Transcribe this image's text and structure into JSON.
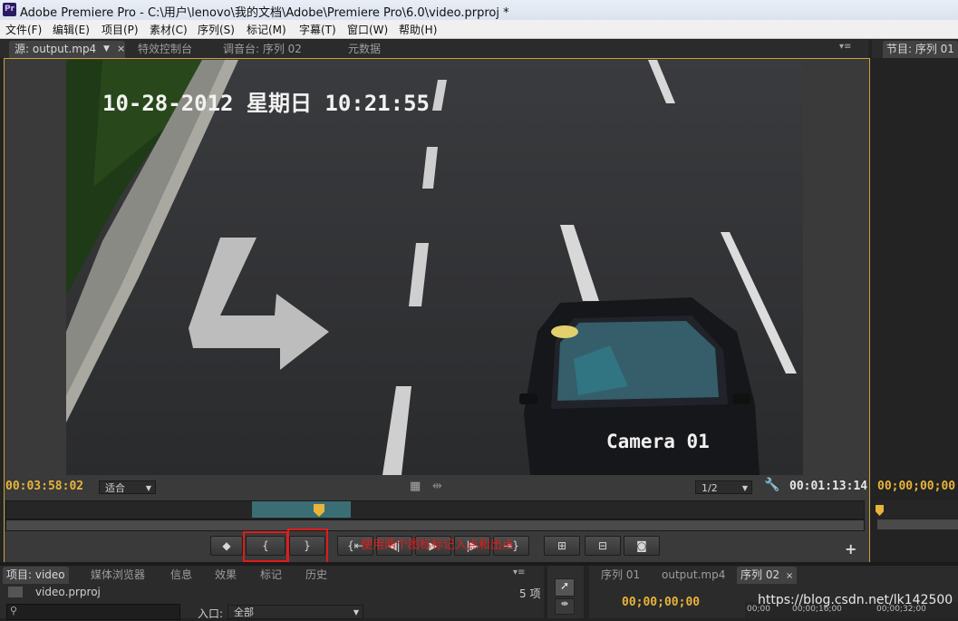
{
  "titlebar": {
    "app_icon": "Pr",
    "title": "Adobe Premiere Pro - C:\\用户\\lenovo\\我的文档\\Adobe\\Premiere Pro\\6.0\\video.prproj *"
  },
  "menu": [
    "文件(F)",
    "编辑(E)",
    "项目(P)",
    "素材(C)",
    "序列(S)",
    "标记(M)",
    "字幕(T)",
    "窗口(W)",
    "帮助(H)"
  ],
  "source_tabs": {
    "source": "源: output.mp4",
    "effect_controls": "特效控制台",
    "audio_mixer": "调音台: 序列 02",
    "metadata": "元数据"
  },
  "program_tab": "节目: 序列 01",
  "video_overlay": {
    "datetime": "10-28-2012 星期日 10:21:55",
    "camera": "Camera 01"
  },
  "source_controls": {
    "current_tc": "00:03:58:02",
    "fit": "适合",
    "resolution": "1/2",
    "duration_tc": "00:01:13:14"
  },
  "program_tc": "00;00;00;00",
  "transport": {
    "mark_in": "{",
    "mark_out": "}",
    "annotation": "使用两个图标标记入点和出点"
  },
  "project_tabs": {
    "project": "项目: video",
    "media_browser": "媒体浏览器",
    "info": "信息",
    "effects": "效果",
    "markers": "标记",
    "history": "历史"
  },
  "project": {
    "file": "video.prproj",
    "count": "5 项",
    "in_label": "入口:",
    "in_value": "全部"
  },
  "timeline_tabs": {
    "seq01": "序列 01",
    "output": "output.mp4",
    "seq02": "序列 02"
  },
  "timeline": {
    "tc": "00;00;00;00",
    "ruler": [
      "00;00",
      "00;00;16;00",
      "00;00;32;00"
    ]
  },
  "watermark": "https://blog.csdn.net/lk142500",
  "colors": {
    "accent": "#e8b43a",
    "teal": "#3a6e74",
    "red": "#e01b1b"
  }
}
